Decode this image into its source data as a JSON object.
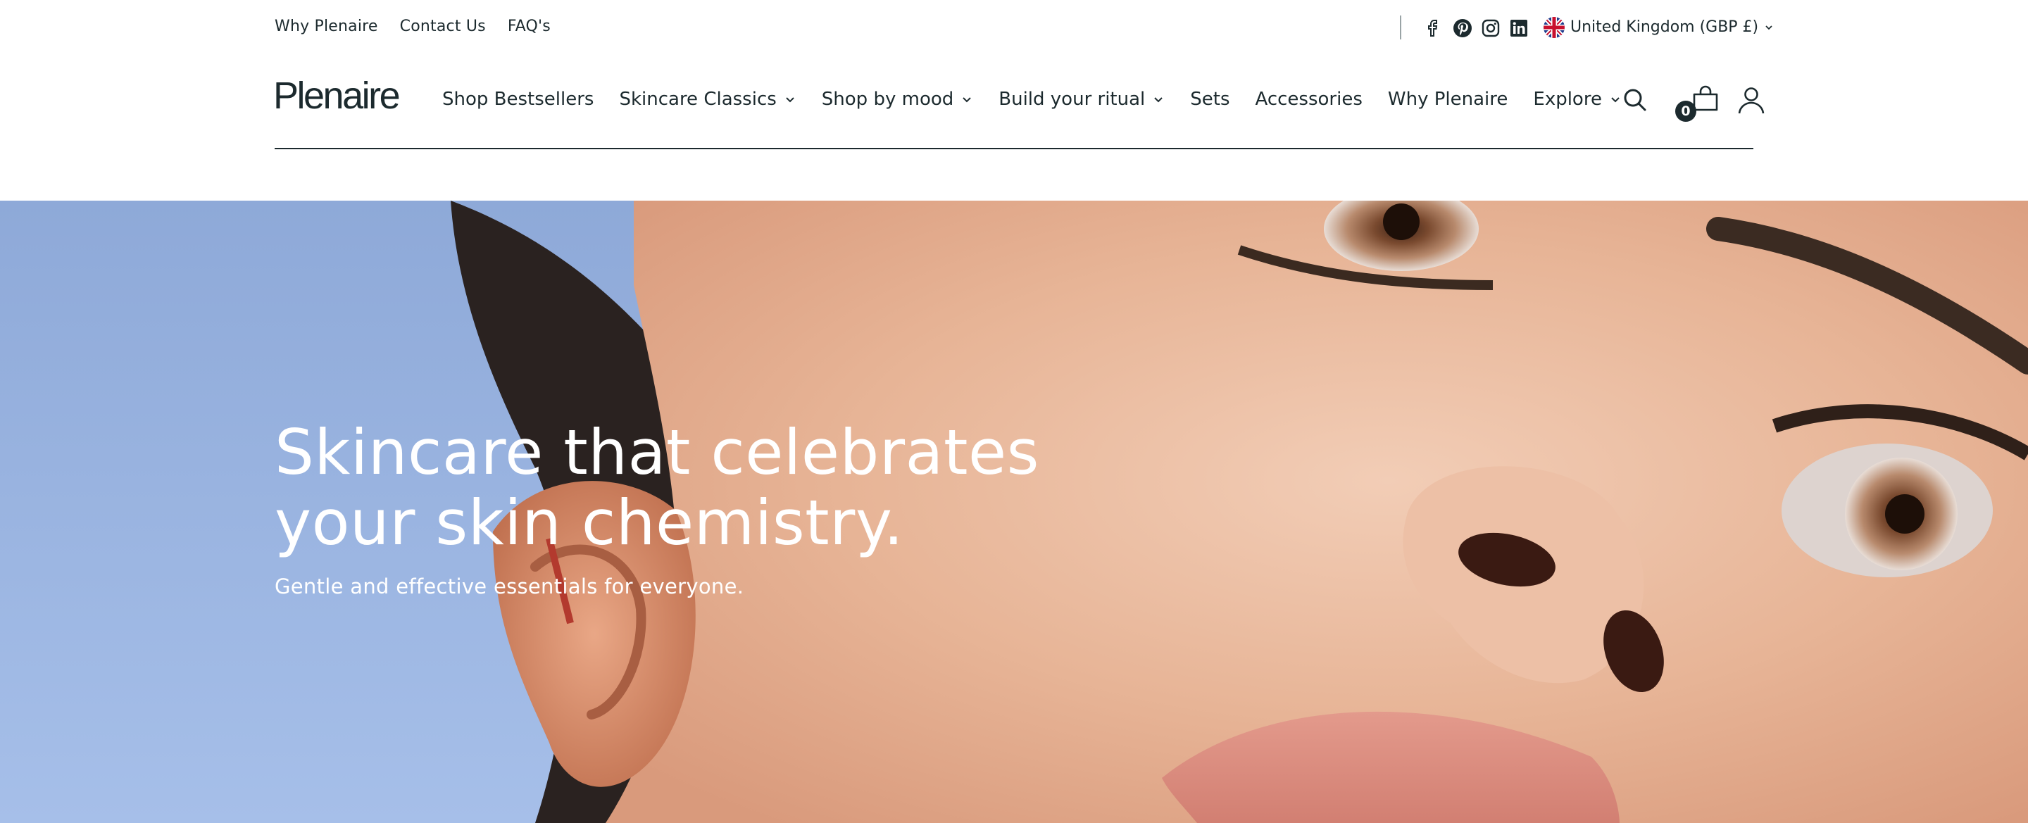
{
  "utility_links": [
    "Why Plenaire",
    "Contact Us",
    "FAQ's"
  ],
  "social_icons": [
    "facebook-icon",
    "pinterest-icon",
    "instagram-icon",
    "linkedin-icon"
  ],
  "locale": {
    "label": "United Kingdom (GBP £)",
    "flag": "uk-flag-icon"
  },
  "brand": {
    "logo_text": "Plenaire"
  },
  "nav": {
    "items": [
      {
        "label": "Shop Bestsellers",
        "has_dropdown": false
      },
      {
        "label": "Skincare Classics",
        "has_dropdown": true
      },
      {
        "label": "Shop by mood",
        "has_dropdown": true
      },
      {
        "label": "Build your ritual",
        "has_dropdown": true
      },
      {
        "label": "Sets",
        "has_dropdown": false
      },
      {
        "label": "Accessories",
        "has_dropdown": false
      },
      {
        "label": "Why Plenaire",
        "has_dropdown": false
      },
      {
        "label": "Explore",
        "has_dropdown": true
      }
    ]
  },
  "header_icons": [
    "search-icon",
    "cart-icon",
    "account-icon"
  ],
  "cart": {
    "count": "0"
  },
  "hero": {
    "heading_line1": "Skincare that celebrates",
    "heading_line2": "your skin chemistry.",
    "subheading": "Gentle and effective essentials for everyone."
  },
  "colors": {
    "text": "#1c2a2e",
    "hero_sky": "#9ab4e2",
    "hero_skin": "#e9b99c",
    "white": "#ffffff"
  }
}
